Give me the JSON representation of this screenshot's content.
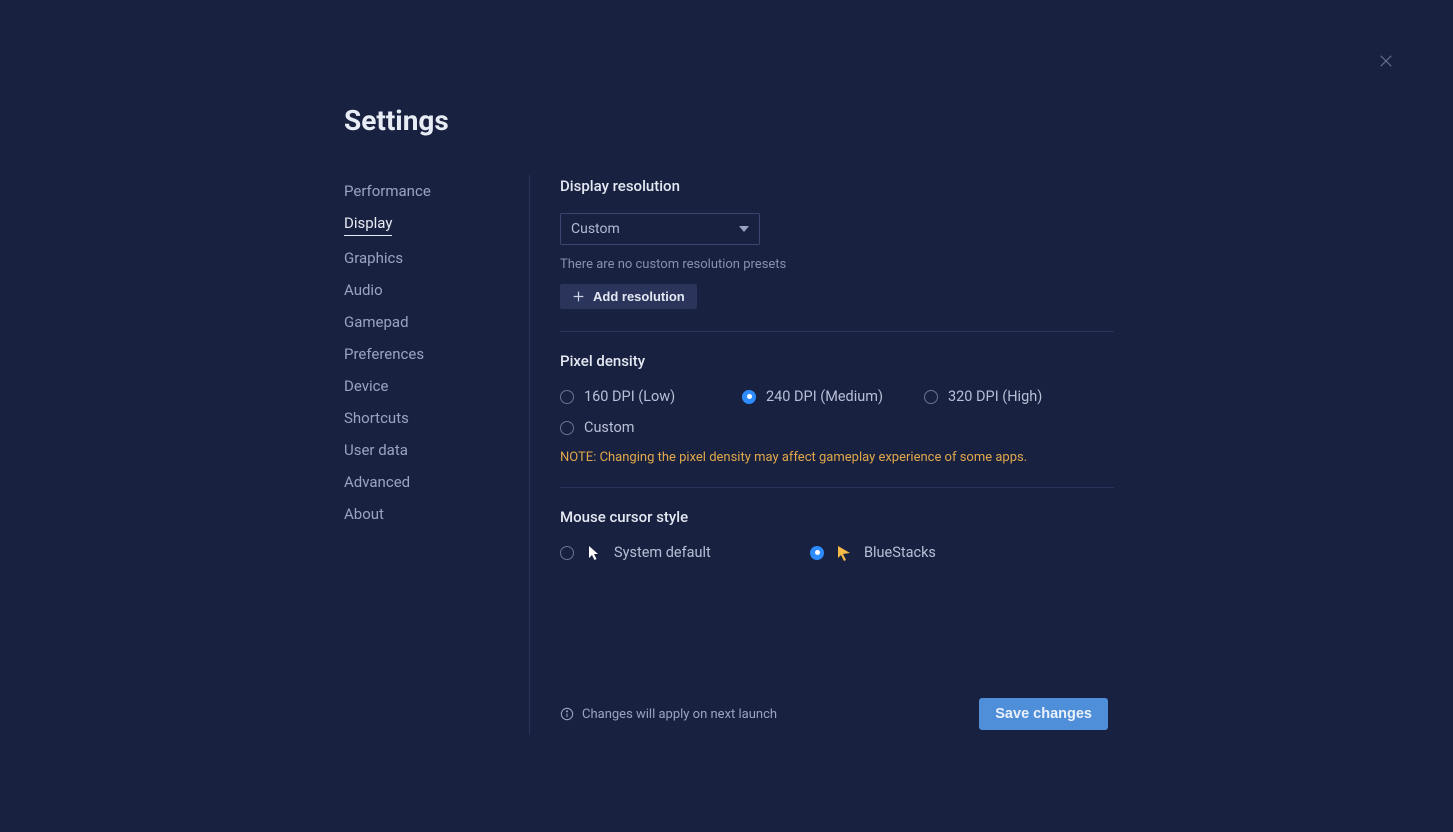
{
  "page_title": "Settings",
  "sidebar": {
    "items": [
      {
        "label": "Performance"
      },
      {
        "label": "Display"
      },
      {
        "label": "Graphics"
      },
      {
        "label": "Audio"
      },
      {
        "label": "Gamepad"
      },
      {
        "label": "Preferences"
      },
      {
        "label": "Device"
      },
      {
        "label": "Shortcuts"
      },
      {
        "label": "User data"
      },
      {
        "label": "Advanced"
      },
      {
        "label": "About"
      }
    ],
    "active_index": 1
  },
  "sections": {
    "resolution": {
      "title": "Display resolution",
      "select_value": "Custom",
      "hint": "There are no custom resolution presets",
      "add_button": "Add resolution"
    },
    "density": {
      "title": "Pixel density",
      "options": [
        {
          "label": "160 DPI (Low)",
          "checked": false
        },
        {
          "label": "240 DPI (Medium)",
          "checked": true
        },
        {
          "label": "320 DPI (High)",
          "checked": false
        },
        {
          "label": "Custom",
          "checked": false
        }
      ],
      "note": "NOTE: Changing the pixel density may affect gameplay experience of some apps."
    },
    "cursor": {
      "title": "Mouse cursor style",
      "options": [
        {
          "label": "System default",
          "checked": false
        },
        {
          "label": "BlueStacks",
          "checked": true
        }
      ]
    }
  },
  "footer": {
    "note": "Changes will apply on next launch",
    "save": "Save changes"
  }
}
